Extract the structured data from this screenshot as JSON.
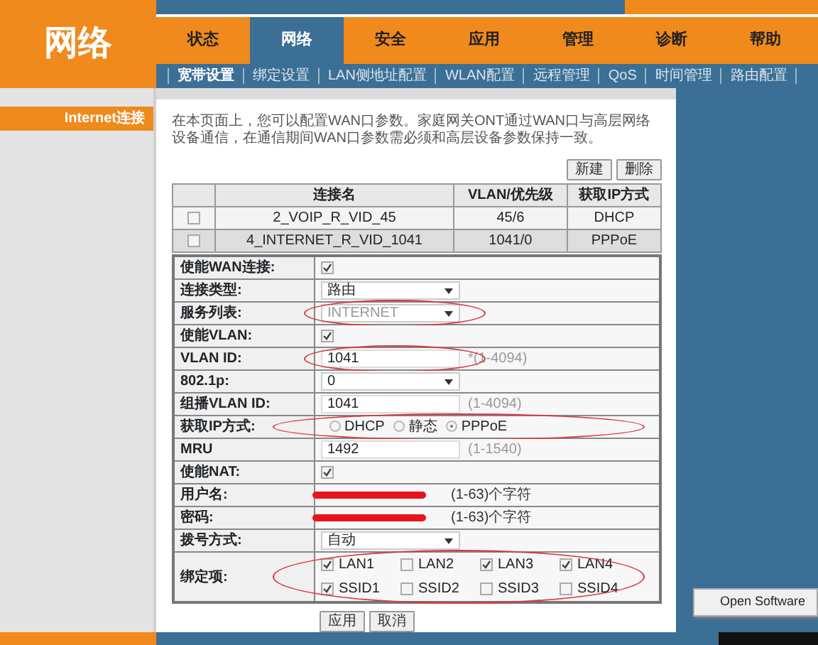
{
  "logo_title": "网络",
  "main_tabs": [
    {
      "label": "状态",
      "selected": false
    },
    {
      "label": "网络",
      "selected": true
    },
    {
      "label": "安全",
      "selected": false
    },
    {
      "label": "应用",
      "selected": false
    },
    {
      "label": "管理",
      "selected": false
    },
    {
      "label": "诊断",
      "selected": false
    },
    {
      "label": "帮助",
      "selected": false
    }
  ],
  "sub_tabs": [
    {
      "label": "宽带设置",
      "selected": true
    },
    {
      "label": "绑定设置",
      "selected": false
    },
    {
      "label": "LAN侧地址配置",
      "selected": false
    },
    {
      "label": "WLAN配置",
      "selected": false
    },
    {
      "label": "远程管理",
      "selected": false
    },
    {
      "label": "QoS",
      "selected": false
    },
    {
      "label": "时间管理",
      "selected": false
    },
    {
      "label": "路由配置",
      "selected": false
    }
  ],
  "sidebar": {
    "items": [
      {
        "label": "Internet连接",
        "selected": true
      }
    ]
  },
  "intro": "在本页面上，您可以配置WAN口参数。家庭网关ONT通过WAN口与高层网络设备通信，在通信期间WAN口参数需必须和高层设备参数保持一致。",
  "table_buttons": [
    "新建",
    "删除"
  ],
  "wan_table": {
    "columns": [
      "连接名",
      "VLAN/优先级",
      "获取IP方式"
    ],
    "rows": [
      {
        "checked": false,
        "name": "2_VOIP_R_VID_45",
        "vlan": "45/6",
        "ip_method": "DHCP"
      },
      {
        "checked": false,
        "name": "4_INTERNET_R_VID_1041",
        "vlan": "1041/0",
        "ip_method": "PPPoE"
      }
    ]
  },
  "form": [
    {
      "kind": "checkbox",
      "label": "使能WAN连接:",
      "checked": true,
      "circled": false
    },
    {
      "kind": "select",
      "label": "连接类型:",
      "value": "路由",
      "disabled": false,
      "circled": false
    },
    {
      "kind": "select",
      "label": "服务列表:",
      "value": "INTERNET",
      "disabled": true,
      "circled": true
    },
    {
      "kind": "checkbox",
      "label": "使能VLAN:",
      "checked": true,
      "circled": false
    },
    {
      "kind": "text",
      "label": "VLAN ID:",
      "value": "1041",
      "hint": "*(1-4094)",
      "circled": true
    },
    {
      "kind": "select",
      "label": "802.1p:",
      "value": "0",
      "disabled": false,
      "circled": false
    },
    {
      "kind": "text",
      "label": "组播VLAN ID:",
      "value": "1041",
      "hint": "(1-4094)",
      "circled": false
    },
    {
      "kind": "radio",
      "label": "获取IP方式:",
      "options": [
        {
          "label": "DHCP",
          "selected": false
        },
        {
          "label": "静态",
          "selected": false
        },
        {
          "label": "PPPoE",
          "selected": true
        }
      ],
      "circled": true
    },
    {
      "kind": "text",
      "label": "MRU",
      "value": "1492",
      "hint": "(1-1540)",
      "circled": false
    },
    {
      "kind": "checkbox",
      "label": "使能NAT:",
      "checked": true,
      "circled": false
    },
    {
      "kind": "redacted",
      "label": "用户名:",
      "hint": "(1-63)个字符",
      "circled": false
    },
    {
      "kind": "redacted",
      "label": "密码:",
      "hint": "(1-63)个字符",
      "circled": false
    },
    {
      "kind": "select",
      "label": "拨号方式:",
      "value": "自动",
      "disabled": false,
      "circled": false
    },
    {
      "kind": "bind",
      "label": "绑定项:",
      "options": [
        {
          "label": "LAN1",
          "checked": true
        },
        {
          "label": "LAN2",
          "checked": false
        },
        {
          "label": "LAN3",
          "checked": true
        },
        {
          "label": "LAN4",
          "checked": true
        },
        {
          "label": "SSID1",
          "checked": true
        },
        {
          "label": "SSID2",
          "checked": false
        },
        {
          "label": "SSID3",
          "checked": false
        },
        {
          "label": "SSID4",
          "checked": false
        }
      ],
      "circled": true
    }
  ],
  "form_buttons": [
    "应用",
    "取消"
  ],
  "context_menu": {
    "items": [
      "Open Software"
    ]
  }
}
